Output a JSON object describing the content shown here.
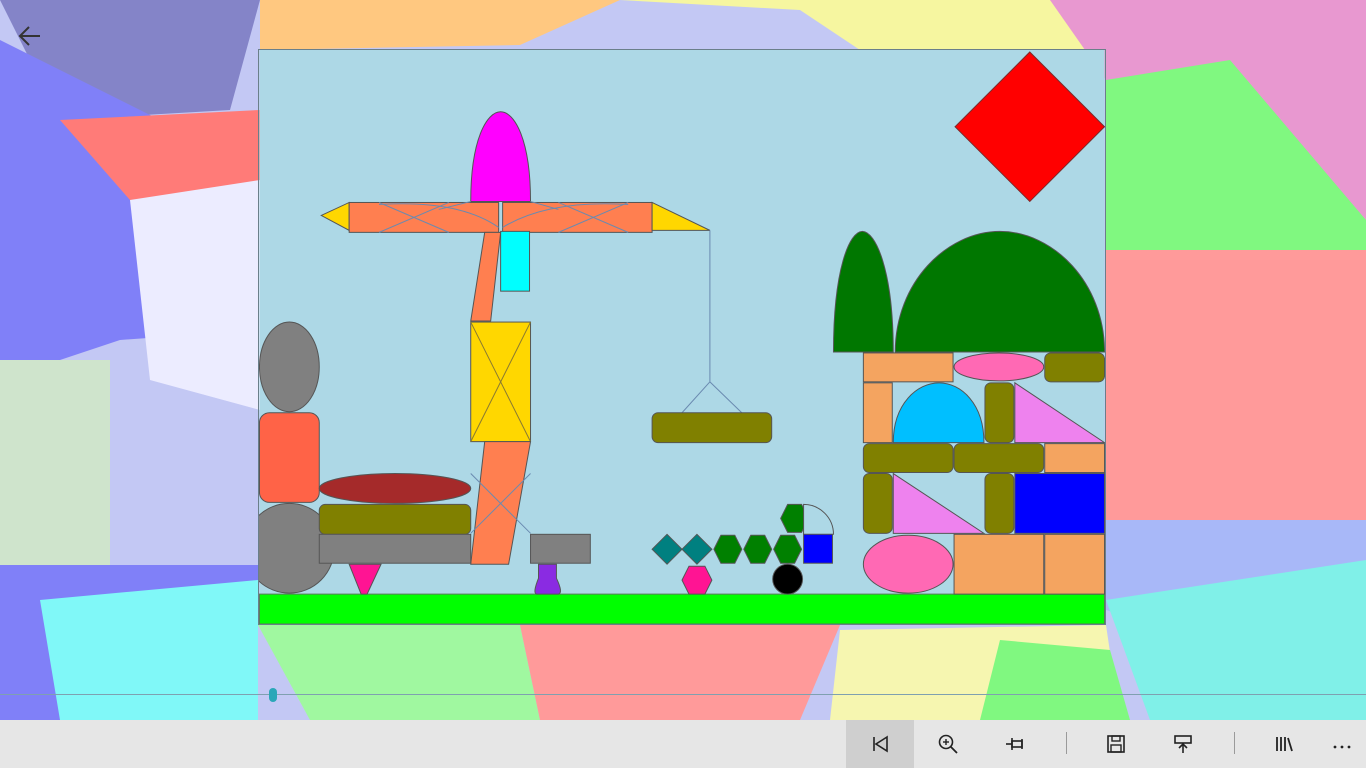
{
  "app": {
    "icons": {
      "back": "back-arrow-icon",
      "restart": "skip-to-start-icon",
      "zoom": "zoom-in-icon",
      "pin": "pin-icon",
      "save": "save-icon",
      "share": "upload-icon",
      "library": "library-icon",
      "more": "more-icon"
    }
  },
  "timeline": {
    "position": 0.2
  },
  "scene": {
    "sky_color": "#add8e6",
    "ground_color": "#00ff00",
    "accent_colors": {
      "red_diamond": "#ff0000",
      "magenta_dome": "#ff00ff",
      "coral_beam": "#ff7f50",
      "yellow": "#ffd700",
      "cyan": "#00ffff",
      "olive": "#808000",
      "dark_green": "#007700",
      "sand": "#f4a460",
      "pink": "#ff69b4",
      "sky_blue_dome": "#00bfff",
      "violet": "#ee82ee",
      "blue": "#0000ff",
      "gray": "#808080",
      "tomato": "#ff6347",
      "brown_red": "#a52a2a",
      "teal": "#008080",
      "deep_pink": "#ff1493",
      "purple": "#8a2be2",
      "black": "#000000"
    }
  }
}
